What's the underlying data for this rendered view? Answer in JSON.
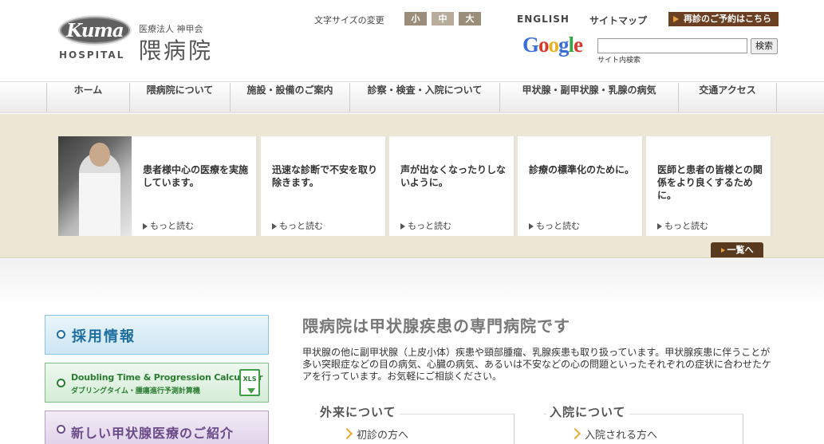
{
  "header": {
    "logo_mark": "Kuma",
    "logo_sub": "HOSPITAL",
    "org": "医療法人 神甲会",
    "name": "隈病院",
    "font_size_label": "文字サイズの変更",
    "font_sizes": [
      "小",
      "中",
      "大"
    ],
    "english": "ENGLISH",
    "sitemap": "サイトマップ",
    "reserve": "再診のご予約はこちら",
    "google": "Google",
    "search_btn": "検索",
    "search_note": "サイト内検索"
  },
  "nav": [
    "ホーム",
    "隈病院について",
    "施設・設備のご案内",
    "診察・検査・入院について",
    "甲状腺・副甲状腺・乳腺の病気",
    "交通アクセス"
  ],
  "cards": [
    {
      "text": "患者様中心の医療を実施しています。",
      "more": "もっと読む"
    },
    {
      "text": "迅速な診断で不安を取り除きます。",
      "more": "もっと読む"
    },
    {
      "text": "声が出なくなったりしないように。",
      "more": "もっと読む"
    },
    {
      "text": "診療の標準化のために。",
      "more": "もっと読む"
    },
    {
      "text": "医師と患者の皆様との関係をより良くするために。",
      "more": "もっと読む"
    }
  ],
  "list_btn": "一覧へ",
  "side": {
    "recruit": "採用情報",
    "doubling": "Doubling Time & Progression Calculator",
    "doubling_sub": "ダブリングタイム・腫瘍進行予測計算機",
    "xls": "XLS",
    "new_treatment": "新しい甲状腺医療のご紹介"
  },
  "main": {
    "title": "隈病院は甲状腺疾患の専門病院です",
    "body": "甲状腺の他に副甲状腺（上皮小体）疾患や頸部腫瘤、乳腺疾患も取り扱っています。甲状腺疾患に伴うことが多い突眼症などの目の病気、心臓の病気、あるいは不安などの心の問題といったそれぞれの症状に合わせたケアを行っています。お気軽にご相談ください。",
    "outpatient_title": "外来について",
    "outpatient_link": "初診の方へ",
    "inpatient_title": "入院について",
    "inpatient_link": "入院される方へ"
  }
}
